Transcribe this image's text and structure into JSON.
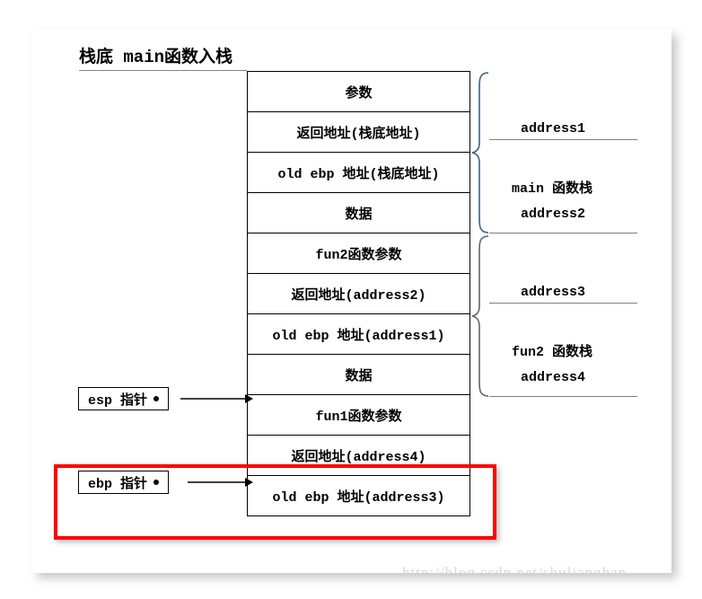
{
  "title": "栈底 main函数入栈",
  "stack": {
    "cells": [
      {
        "label": "参数"
      },
      {
        "label": "返回地址(栈底地址)"
      },
      {
        "label": "old ebp 地址(栈底地址)"
      },
      {
        "label": "数据"
      },
      {
        "label": "fun2函数参数"
      },
      {
        "label": "返回地址(address2)"
      },
      {
        "label": "old ebp 地址(address1)"
      },
      {
        "label": "数据"
      },
      {
        "label": "fun1函数参数"
      },
      {
        "label": "返回地址(address4)"
      },
      {
        "label": "old ebp 地址(address3)"
      }
    ]
  },
  "groups": [
    {
      "name": "main 函数栈",
      "top_address": "address1",
      "bottom_address": "address2",
      "brace_color": "#3f5f8f"
    },
    {
      "name": "fun2 函数栈",
      "top_address": "address3",
      "bottom_address": "address4",
      "brace_color": "#666666"
    }
  ],
  "pointers": [
    {
      "label": "esp 指针"
    },
    {
      "label": "ebp 指针"
    }
  ],
  "highlight": {
    "color": "#ff0000"
  },
  "watermark": "http://blog.csdn.net/shulianghan"
}
